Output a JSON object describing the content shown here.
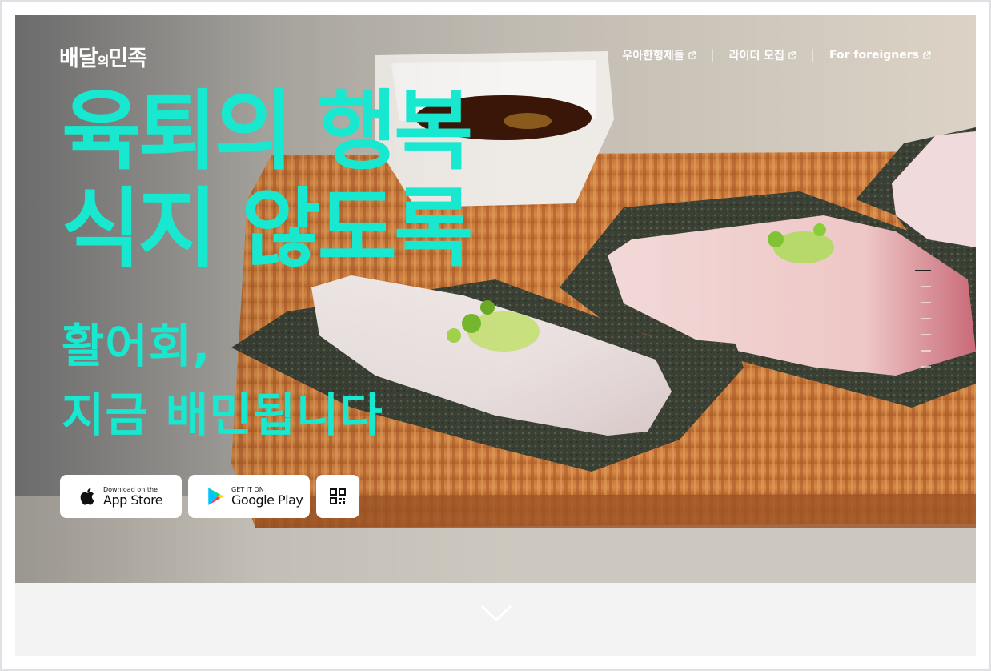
{
  "brand": {
    "logo_text_1": "배달",
    "logo_text_small": "의",
    "logo_text_2": "민족"
  },
  "nav": {
    "items": [
      {
        "label": "우아한형제들"
      },
      {
        "label": "라이더 모집"
      },
      {
        "label": "For foreigners"
      }
    ]
  },
  "hero": {
    "headline_line1": "육퇴의 행복",
    "headline_line2": "식지 않도록",
    "sub_line1": "활어회,",
    "sub_line2": "지금 배민됩니다",
    "accent_color": "#17e8cf"
  },
  "store_buttons": {
    "apple": {
      "small": "Download on the",
      "big": "App Store"
    },
    "google": {
      "small": "GET IT ON",
      "big": "Google Play"
    },
    "qr_icon": "qr-code-icon"
  },
  "pager": {
    "count": 7,
    "active_index": 0
  },
  "scroll_hint_icon": "chevron-down-icon"
}
